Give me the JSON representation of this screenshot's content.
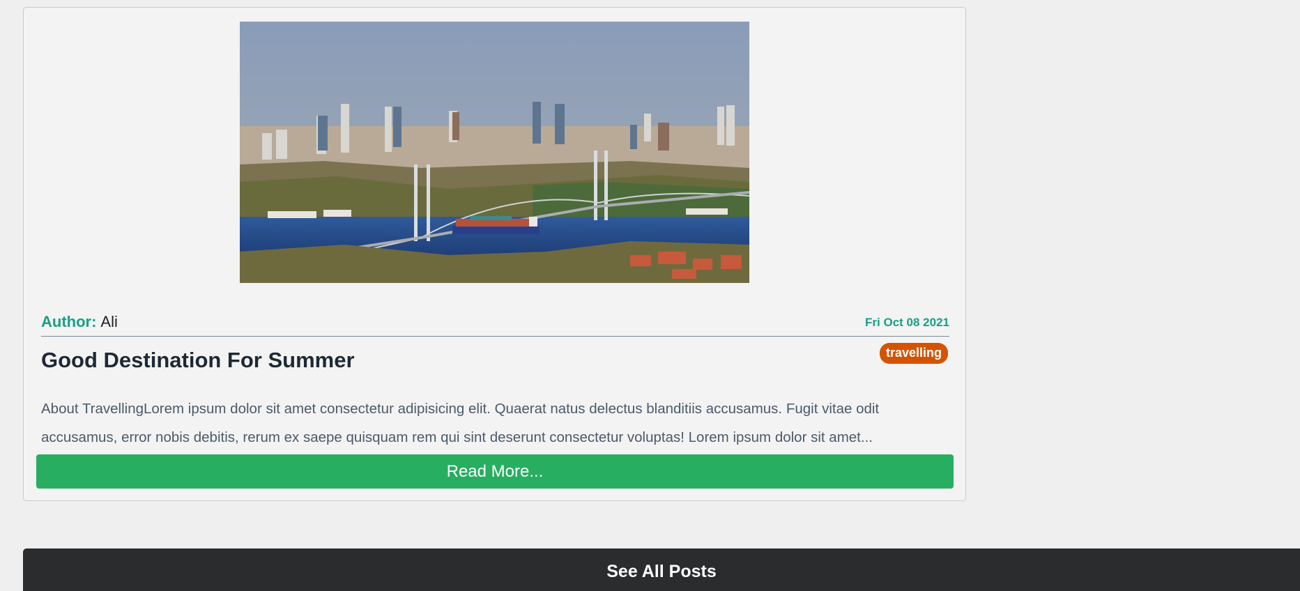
{
  "post": {
    "image_subject": "city-skyline-bridge-photo",
    "author_label": "Author:",
    "author_name": "Ali",
    "date": "Fri Oct 08 2021",
    "title": "Good Destination For Summer",
    "tag": "travelling",
    "excerpt": "About TravellingLorem ipsum dolor sit amet consectetur adipisicing elit. Quaerat natus delectus blanditiis accusamus. Fugit vitae odit accusamus, error nobis debitis, rerum ex saepe quisquam rem qui sint deserunt consectetur voluptas! Lorem ipsum dolor sit amet...",
    "read_more_label": "Read More..."
  },
  "footer": {
    "see_all_label": "See All Posts"
  },
  "colors": {
    "accent_teal": "#17a085",
    "tag_orange": "#d35400",
    "button_green": "#27ae60",
    "dark_button": "#2a2c2e"
  }
}
